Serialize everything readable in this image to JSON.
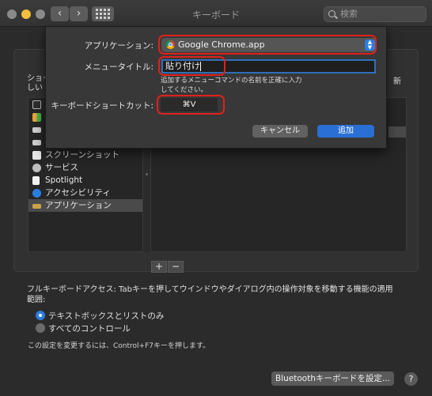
{
  "window": {
    "title": "キーボード",
    "search_placeholder": "検索",
    "back_glyph": "‹",
    "forward_glyph": "›"
  },
  "background": {
    "left_heading": "ショー\nしい",
    "right_heading": "新",
    "list_items": [
      {
        "label": "",
        "icon": "display-icon"
      },
      {
        "label": "",
        "icon": "mission-control-icon"
      },
      {
        "label": "",
        "icon": "keyboard-icon"
      },
      {
        "label": "",
        "icon": "input-icon"
      },
      {
        "label": "スクリーンショット",
        "icon": "screenshot-icon"
      },
      {
        "label": "サービス",
        "icon": "gear-icon"
      },
      {
        "label": "Spotlight",
        "icon": "spotlight-icon"
      },
      {
        "label": "アクセシビリティ",
        "icon": "accessibility-icon"
      },
      {
        "label": "アプリケーション",
        "icon": "app-shortcuts-icon"
      }
    ],
    "selected_index": 8,
    "add_label": "+",
    "remove_label": "−",
    "full_keyboard_access": "フルキーボードアクセス: Tabキーを押してウインドウやダイアログ内の操作対象を移動する機能の適用範囲:",
    "radio_options": [
      "テキストボックスとリストのみ",
      "すべてのコントロール"
    ],
    "radio_selected": 0,
    "change_note": "この設定を変更するには、Control+F7キーを押します。",
    "bluetooth_button": "Bluetoothキーボードを設定...",
    "help_label": "?"
  },
  "sheet": {
    "application_label": "アプリケーション:",
    "application_value": "Google Chrome.app",
    "menu_title_label": "メニュータイトル:",
    "menu_title_value": "貼り付け",
    "hint": "追加するメニューコマンドの名前を正確に入力してください。",
    "shortcut_label": "キーボードショートカット:",
    "shortcut_value": "⌘V",
    "cancel_button": "キャンセル",
    "add_button": "追加"
  },
  "colors": {
    "accent": "#2a7de1",
    "highlight_ring": "#e0211b",
    "window_bg": "#2b2b2b",
    "sheet_bg": "#383838"
  }
}
